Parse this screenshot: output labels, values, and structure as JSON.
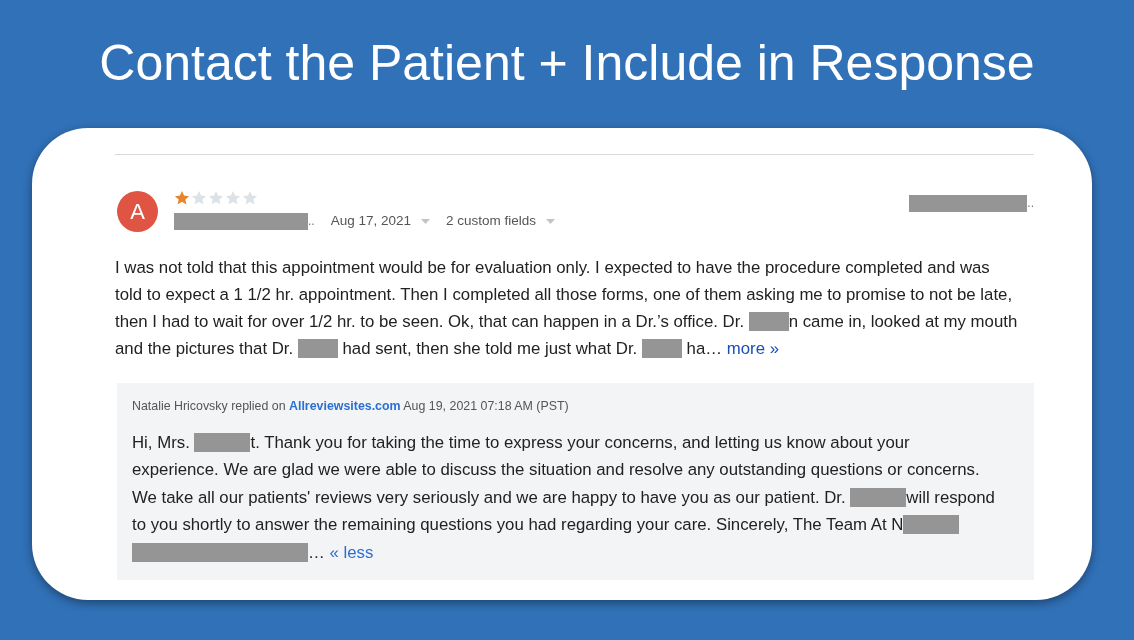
{
  "slide": {
    "title": "Contact the Patient + Include in Response"
  },
  "review": {
    "avatar_letter": "A",
    "stars": 1,
    "reviewer": [
      {
        "kind": "redacted"
      },
      {
        "kind": "text",
        "text": ".."
      }
    ],
    "date": "Aug 17, 2021",
    "custom_fields": "2 custom fields",
    "source": [
      {
        "kind": "redacted"
      },
      {
        "kind": "text",
        "text": ".."
      }
    ],
    "text": [
      {
        "kind": "text",
        "text": "I was not told that this appointment would be for evaluation only. I expected to have the procedure completed and was told to expect a 1 1/2 hr. appointment. Then I completed all those forms, one of them asking me to promise to not be late, then I had to wait for over 1/2 hr. to be seen. Ok, that can happen in a Dr.’s office. Dr. "
      },
      {
        "kind": "redacted"
      },
      {
        "kind": "text",
        "text": "n came in, looked at my mouth and the pictures that Dr. "
      },
      {
        "kind": "redacted"
      },
      {
        "kind": "text",
        "text": " had sent, then she told me just what Dr. "
      },
      {
        "kind": "redacted"
      },
      {
        "kind": "text",
        "text": " ha… "
      }
    ],
    "more_link": "more »",
    "reply": {
      "author": "Natalie Hricovsky replied on",
      "site": "Allreviewsites.com",
      "timestamp": "Aug 19, 2021 07:18 AM (PST)",
      "text": [
        {
          "kind": "text",
          "text": "Hi, Mrs. "
        },
        {
          "kind": "redacted"
        },
        {
          "kind": "text",
          "text": "t. Thank you for taking the time to express your concerns, and letting us know about your experience. We are glad we were able to discuss the situation and resolve any outstanding questions or concerns. We take all our patients' reviews very seriously and we are happy to have you as our patient. Dr. "
        },
        {
          "kind": "redacted"
        },
        {
          "kind": "text",
          "text": "will respond to you shortly to answer the remaining questions you had regarding your care. Sincerely, The Team At N"
        },
        {
          "kind": "redacted"
        },
        {
          "kind": "redacted"
        },
        {
          "kind": "text",
          "text": "… "
        }
      ],
      "less_link": "« less"
    }
  }
}
